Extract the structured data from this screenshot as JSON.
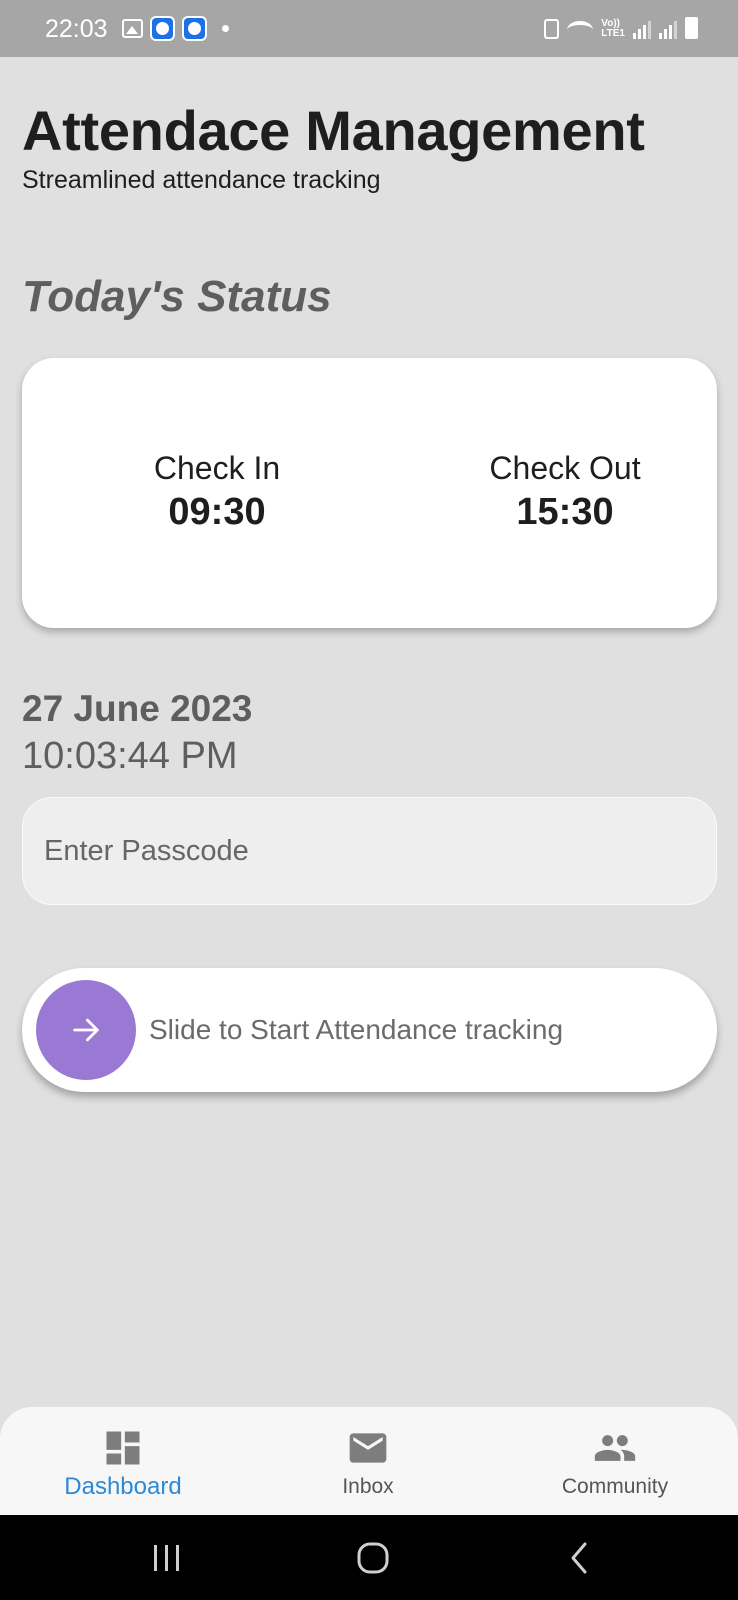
{
  "status_bar": {
    "time": "22:03",
    "network": "LTE1",
    "volte": "Vo))"
  },
  "header": {
    "title": "Attendace Management",
    "subtitle": "Streamlined attendance tracking"
  },
  "section": {
    "title": "Today's Status"
  },
  "status_card": {
    "check_in_label": "Check In",
    "check_in_time": "09:30",
    "check_out_label": "Check Out",
    "check_out_time": "15:30"
  },
  "datetime": {
    "date": "27 June 2023",
    "time": "10:03:44 PM"
  },
  "passcode": {
    "placeholder": "Enter Passcode",
    "value": ""
  },
  "slider": {
    "label": "Slide to Start Attendance tracking",
    "knob_color": "#9a79d4"
  },
  "bottom_nav": {
    "items": [
      {
        "label": "Dashboard",
        "icon": "dashboard-icon",
        "active": true
      },
      {
        "label": "Inbox",
        "icon": "mail-icon",
        "active": false
      },
      {
        "label": "Community",
        "icon": "people-icon",
        "active": false
      }
    ],
    "active_color": "#2e8ad6"
  },
  "colors": {
    "background": "#e0e0e0",
    "statusbar": "#a6a6a6",
    "muted_text": "#5e5e5e"
  }
}
